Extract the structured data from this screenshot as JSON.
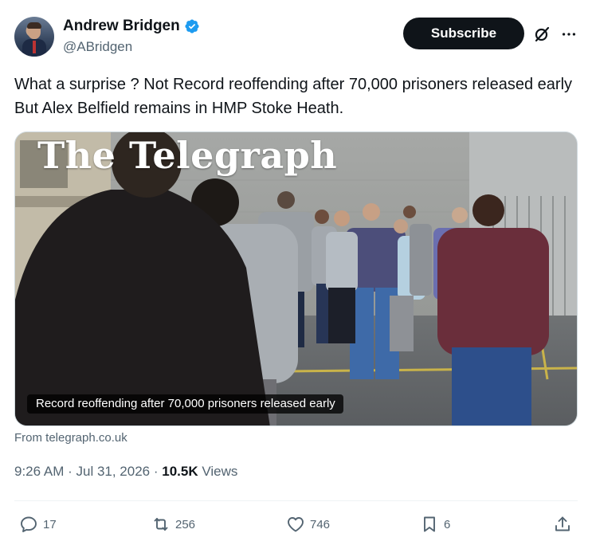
{
  "author": {
    "display_name": "Andrew Bridgen",
    "handle": "@ABridgen",
    "verified": true
  },
  "header_actions": {
    "subscribe_label": "Subscribe",
    "grok_icon": "grok-icon",
    "more_icon": "more-icon"
  },
  "tweet": {
    "text": "What a surprise ? Not Record reoffending after 70,000 prisoners released early But Alex Belfield remains in HMP Stoke Heath."
  },
  "card": {
    "masthead": "The Telegraph",
    "caption": "Record reoffending after 70,000 prisoners released early",
    "source": "From telegraph.co.uk"
  },
  "meta": {
    "time": "9:26 AM",
    "date": "Jul 31, 2026",
    "views_count": "10.5K",
    "views_label": "Views"
  },
  "actions": {
    "replies": "17",
    "reposts": "256",
    "likes": "746",
    "bookmarks": "6"
  },
  "colors": {
    "text_primary": "#0f1419",
    "text_secondary": "#536471",
    "verified_blue": "#1d9bf0",
    "button_dark": "#0f1419"
  }
}
